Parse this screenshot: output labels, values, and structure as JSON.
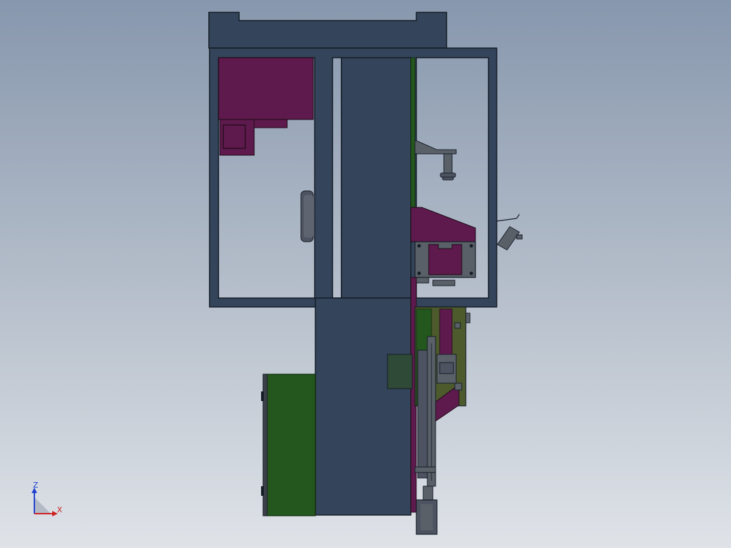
{
  "scene": {
    "colors": {
      "frame": "#34445a",
      "frame_edge": "#151c26",
      "magenta": "#5e1a4c",
      "green": "#23571d",
      "olive": "#4d5a2c",
      "gray_metal": "#5a6068",
      "background_top": "#8797ad",
      "background_bottom": "#dfe3e8"
    },
    "parts": [
      "top-rail",
      "outer-frame",
      "center-column",
      "magenta-motor-block",
      "round-hub",
      "green-plate-upper",
      "top-bracket-arm",
      "magenta-wedge",
      "control-box",
      "side-switch",
      "lower-assembly-plate",
      "green-motor-box",
      "vertical-actuator",
      "bottom-cylinder"
    ]
  },
  "triad": {
    "z_label": "Z",
    "x_label": "X",
    "z_color": "#1f3fd0",
    "x_color": "#d01f1f"
  }
}
